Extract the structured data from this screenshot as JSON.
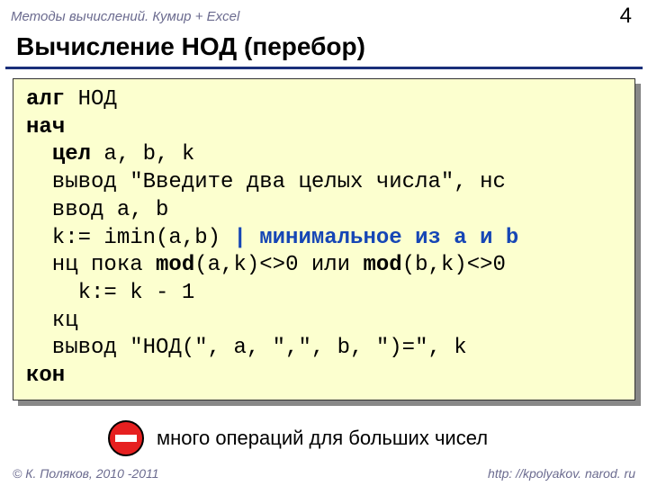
{
  "header": {
    "course": "Методы вычислений. Кумир + Excel",
    "page": "4"
  },
  "title": "Вычисление НОД (перебор)",
  "code": {
    "l1_kw": "алг",
    "l1_rest": " НОД",
    "l2_kw": "нач",
    "l3_pad": "  ",
    "l3_kw": "цел",
    "l3_rest": " a, b, k",
    "l4": "  вывод \"Введите два целых числа\", нс",
    "l5": "  ввод a, b",
    "l6_a": "  k:= imin(a,b) ",
    "l6_c": "| минимальное из a и b",
    "l7_a": "  нц пока ",
    "l7_m1": "mod",
    "l7_b": "(a,k)<>0 или ",
    "l7_m2": "mod",
    "l7_c": "(b,k)<>0",
    "l8": "    k:= k - 1",
    "l9": "  кц",
    "l10": "  вывод \"НОД(\", a, \",\", b, \")=\", k",
    "l11_kw": "кон"
  },
  "note": "много операций для больших чисел",
  "footer": {
    "left": "© К. Поляков, 2010 -2011",
    "right": "http: //kpolyakov. narod. ru"
  }
}
